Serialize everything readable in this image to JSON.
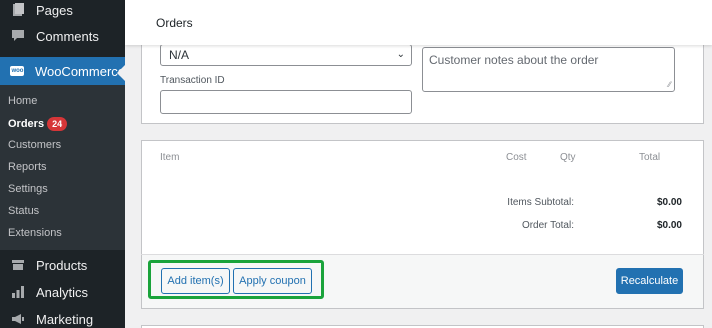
{
  "sidebar": {
    "top_items": [
      {
        "label": "Pages",
        "icon": "pages-icon"
      },
      {
        "label": "Comments",
        "icon": "comments-icon"
      },
      {
        "label": "WooCommerce",
        "icon": "woocommerce-icon"
      },
      {
        "label": "Products",
        "icon": "products-icon"
      },
      {
        "label": "Analytics",
        "icon": "analytics-icon"
      },
      {
        "label": "Marketing",
        "icon": "marketing-icon"
      }
    ],
    "woo_logo_text": "woo",
    "submenu": [
      {
        "label": "Home"
      },
      {
        "label": "Orders",
        "badge": "24"
      },
      {
        "label": "Customers"
      },
      {
        "label": "Reports"
      },
      {
        "label": "Settings"
      },
      {
        "label": "Status"
      },
      {
        "label": "Extensions"
      }
    ]
  },
  "header": {
    "title": "Orders"
  },
  "order_details": {
    "payment_select_value": "N/A",
    "transaction_label": "Transaction ID",
    "transaction_value": "",
    "customer_notes_placeholder": "Customer notes about the order"
  },
  "items": {
    "columns": [
      "Item",
      "Cost",
      "Qty",
      "Total"
    ],
    "subtotal_label": "Items Subtotal:",
    "subtotal_value": "$0.00",
    "total_label": "Order Total:",
    "total_value": "$0.00",
    "add_items_label": "Add item(s)",
    "apply_coupon_label": "Apply coupon",
    "recalculate_label": "Recalculate"
  },
  "colors": {
    "admin_dark": "#1d2327",
    "accent_blue": "#2271b1",
    "badge_red": "#d63638",
    "highlight_green": "#1aa33b"
  }
}
